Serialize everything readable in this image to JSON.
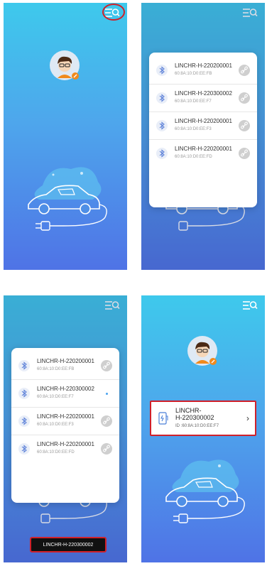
{
  "screens": {
    "s1": {},
    "s2": {
      "devices": [
        {
          "name": "LINCHR-H-220200001",
          "mac": "60:8A:10:D0:EE:FB"
        },
        {
          "name": "LINCHR-H-220300002",
          "mac": "60:8A:10:D0:EE:F7"
        },
        {
          "name": "LINCHR-H-220200001",
          "mac": "60:8A:10:D0:EE:F3"
        },
        {
          "name": "LINCHR-H-220200001",
          "mac": "60:8A:10:D0:EE:FD"
        }
      ]
    },
    "s3": {
      "devices": [
        {
          "name": "LINCHR-H-220200001",
          "mac": "60:8A:10:D0:EE:FB"
        },
        {
          "name": "LINCHR-H-220300002",
          "mac": "60:8A:10:D0:EE:F7"
        },
        {
          "name": "LINCHR-H-220200001",
          "mac": "60:8A:10:D0:EE:F3"
        },
        {
          "name": "LINCHR-H-220200001",
          "mac": "60:8A:10:D0:EE:FD"
        }
      ],
      "toast": "LINCHR-H-220300002"
    },
    "s4": {
      "card": {
        "name_line1": "LINCHR-",
        "name_line2": "H-220300002",
        "id": "ID :60:8A:10:D0:EE:F7"
      }
    }
  },
  "colors": {
    "highlight": "#d0202a",
    "bg_top": "#3ec9ec",
    "bg_bottom": "#4f73e6"
  },
  "icons": [
    "search-menu-icon",
    "avatar-icon",
    "edit-badge-icon",
    "car-charging-illustration",
    "bluetooth-icon",
    "link-icon",
    "charger-icon",
    "chevron-right-icon"
  ]
}
